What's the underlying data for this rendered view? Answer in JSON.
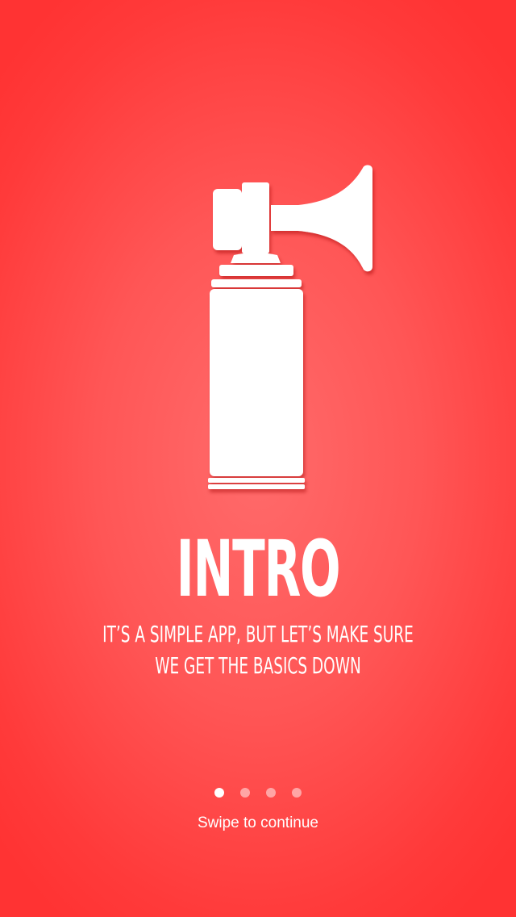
{
  "onboarding": {
    "title": "INTRO",
    "subtitle_line1": "IT’S A SIMPLE APP, BUT LET’S MAKE SURE",
    "subtitle_line2": "WE GET THE BASICS DOWN",
    "hint": "Swipe to continue",
    "hero_icon": "air-horn-icon",
    "page_indicator": {
      "total": 4,
      "current": 1
    }
  },
  "colors": {
    "background_center": "#ff6b6b",
    "background_edge": "#ff3333",
    "foreground": "#ffffff"
  }
}
